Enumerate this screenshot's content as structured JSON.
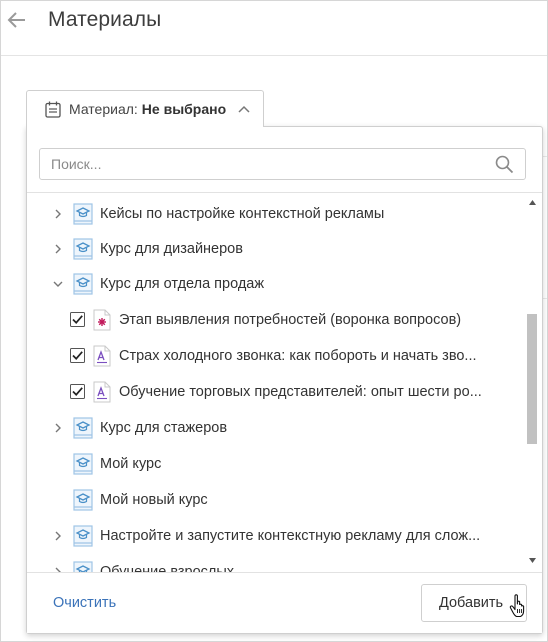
{
  "header": {
    "back_icon": "arrow-left-icon",
    "title": "Материалы"
  },
  "material_selector": {
    "icon": "calendar-icon",
    "label": "Материал:",
    "value": "Не выбрано",
    "chevron": "chevron-up-icon"
  },
  "dropdown": {
    "search": {
      "placeholder": "Поиск...",
      "value": "",
      "icon": "search-icon"
    },
    "tree": [
      {
        "type": "course",
        "label": "Кейсы по настройке контекстной рекламы",
        "expander": "collapsed"
      },
      {
        "type": "course",
        "label": "Курс для дизайнеров",
        "expander": "collapsed"
      },
      {
        "type": "course",
        "label": "Курс для отдела продаж",
        "expander": "expanded"
      },
      {
        "type": "material",
        "label": "Этап выявления потребностей (воронка вопросов)",
        "checked": true,
        "icon": "survey-icon"
      },
      {
        "type": "material",
        "label": "Страх холодного звонка: как побороть и начать зво...",
        "checked": true,
        "icon": "text-document-icon"
      },
      {
        "type": "material",
        "label": "Обучение торговых представителей: опыт шести ро...",
        "checked": true,
        "icon": "text-document-icon"
      },
      {
        "type": "course",
        "label": "Курс для стажеров",
        "expander": "collapsed"
      },
      {
        "type": "course",
        "label": "Мой курс",
        "expander": "none"
      },
      {
        "type": "course",
        "label": "Мой новый курс",
        "expander": "none"
      },
      {
        "type": "course",
        "label": "Настройте и запустите контекстную рекламу для слож...",
        "expander": "collapsed"
      },
      {
        "type": "course",
        "label": "Обучение взрослых",
        "expander": "collapsed"
      }
    ],
    "footer": {
      "clear_label": "Очистить",
      "add_label": "Добавить"
    }
  },
  "colors": {
    "link": "#3b73b9",
    "course_icon": "#4a90c8",
    "survey_icon": "#c2185b",
    "doc_icon": "#7b4fbf",
    "scroll_thumb": "#c1c1c1"
  }
}
